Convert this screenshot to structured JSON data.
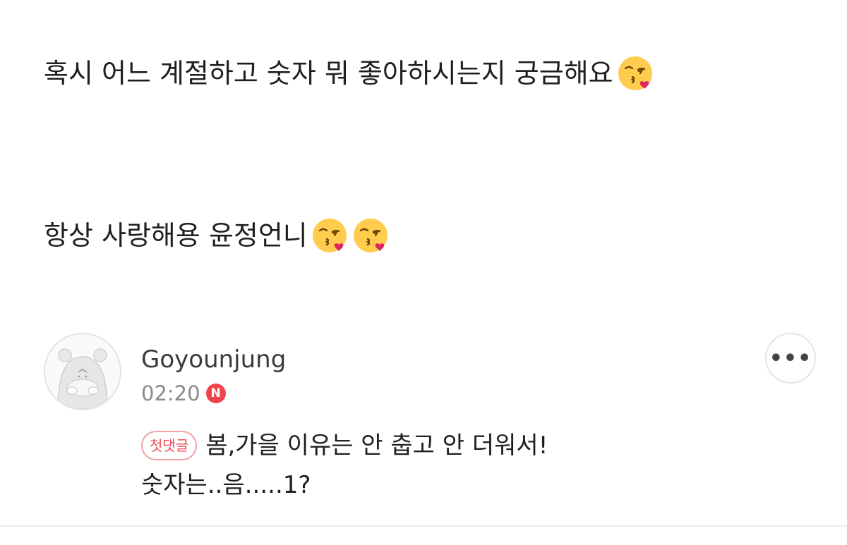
{
  "post": {
    "line1": "혹시 어느 계절하고 숫자 뭐 좋아하시는지 궁금해요",
    "line2": "항상 사랑해용 윤정언니",
    "line1_emoji": "face-blowing-kiss-icon",
    "line2_emojis": [
      "face-blowing-kiss-icon",
      "face-blowing-kiss-icon"
    ]
  },
  "comment": {
    "author": "Goyounjung",
    "time": "02:20",
    "new_badge": "N",
    "first_comment_badge": "첫댓글",
    "text_line1": "봄,가을 이유는 안 춥고 안 더워서!",
    "text_line2": "숫자는..음.....1?",
    "more_label": "•••",
    "avatar_icon": "hamster-avatar-icon"
  },
  "colors": {
    "new_badge": "#f0424b",
    "first_badge_text": "#ef4a52",
    "first_badge_border": "#f3a3a7",
    "text": "#1f1f1f",
    "muted": "#8a8a8a"
  }
}
